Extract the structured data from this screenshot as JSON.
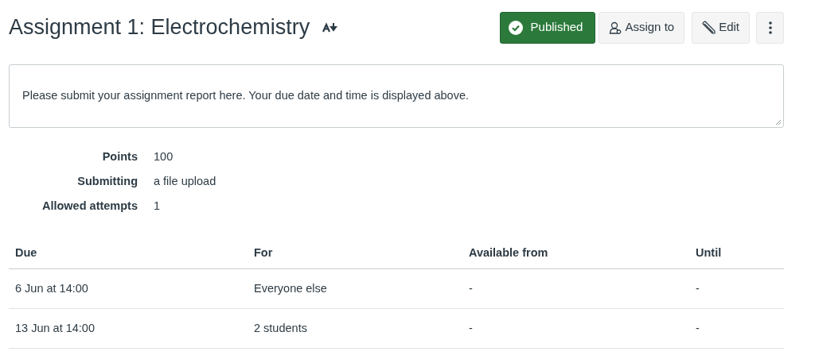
{
  "header": {
    "title": "Assignment 1: Electrochemistry",
    "published": true,
    "publish_label": "Published",
    "buttons": [
      "Assign to",
      "Edit"
    ]
  },
  "description": "Please submit your assignment report here. Your due date and time is displayed above.",
  "details": [
    {
      "label": "Points",
      "value": "100"
    },
    {
      "label": "Submitting",
      "value": "a file upload"
    },
    {
      "label": "Allowed attempts",
      "value": "1"
    }
  ],
  "table": {
    "columns": [
      "Due",
      "For",
      "Available from",
      "Until"
    ],
    "rows": [
      [
        "6 Jun at 14:00",
        "Everyone else",
        "-",
        "-"
      ],
      [
        "13 Jun at 14:00",
        "2 students",
        "-",
        "-"
      ]
    ]
  }
}
